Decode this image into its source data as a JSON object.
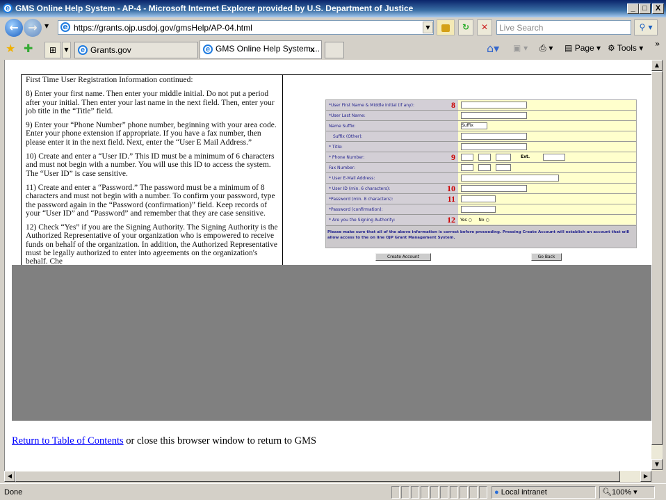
{
  "window": {
    "title": "GMS Online Help System - AP-4 - Microsoft Internet Explorer provided by U.S. Department of Justice",
    "minimize": "_",
    "maximize": "□",
    "close": "X"
  },
  "toolbar": {
    "address": "https://grants.ojp.usdoj.gov/gmsHelp/AP-04.html",
    "search_placeholder": "Live Search"
  },
  "tabs": [
    {
      "label": "Grants.gov"
    },
    {
      "label": "GMS Online Help System ...",
      "close": "x"
    }
  ],
  "commandbar": {
    "page": "Page",
    "tools": "Tools",
    "more": "»"
  },
  "document": {
    "intro": "First Time User Registration Information continued:",
    "step8": "8) Enter your first name. Then enter your middle initial. Do not put a period after your initial. Then enter your last name in the next field. Then, enter your job title in the “Title” field.",
    "step9": "9) Enter your “Phone Number” phone number, beginning with your area code. Enter your phone extension if appropriate. If you have a fax number, then please enter it in the next field. Next, enter the “User E Mail Address.”",
    "step10": "10) Create and enter a “User ID.” This ID must be a minimum of 6 characters and must not begin with a number. You will use this ID to access the system. The “User ID” is case sensitive.",
    "step11": "11) Create and enter a “Password.” The password must be a minimum of 8 characters and must not begin with a number. To confirm your password, type the password again in the “Password (confirmation)” field. Keep records of your “User ID” and “Password” and remember that they are case sensitive.",
    "step12": "12) Check “Yes” if you are the Signing Authority. The Signing Authority is the Authorized Representative of your organization who is empowered to receive funds on behalf of the organization. In addition, the Authorized Representative must be legally authorized to enter into agreements on the organization's behalf. Che"
  },
  "form": {
    "rows": [
      {
        "label": "*User First Name & Middle Initial (if any):",
        "num": "8"
      },
      {
        "label": "*User Last Name:",
        "num": ""
      },
      {
        "label": "Name Suffix:",
        "num": "",
        "select": "Suffix"
      },
      {
        "label": "Suffix (Other):",
        "num": ""
      },
      {
        "label": "* Title:",
        "num": ""
      },
      {
        "label": "* Phone Number:",
        "num": "9",
        "ext": "Ext."
      },
      {
        "label": "Fax Number:",
        "num": ""
      },
      {
        "label": "* User E-Mail Address:",
        "num": ""
      },
      {
        "label": "* User ID (min. 6 characters):",
        "num": "10"
      },
      {
        "label": "*Password (min. 8 characters):",
        "num": "11"
      },
      {
        "label": "*Password (confirmation):",
        "num": ""
      },
      {
        "label": "* Are you the Signing Authority:",
        "num": "12",
        "yes": "Yes",
        "no": "No"
      }
    ],
    "note": "Please make sure that all of the above information is correct before proceeding. Pressing Create Account will establish an account that will allow access to the on line OJP Grant Management System.",
    "create_button": "Create Account",
    "back_button": "Go Back"
  },
  "footer": {
    "link": "Return to Table of Contents",
    "text": " or close this browser window to return to GMS"
  },
  "status": {
    "text": "Done",
    "zone": "Local intranet",
    "zoom": "100%"
  }
}
